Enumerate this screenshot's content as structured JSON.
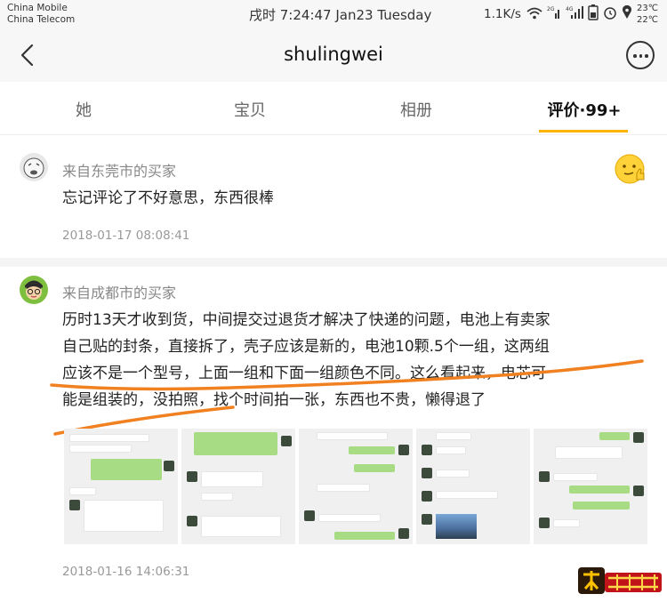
{
  "status_bar": {
    "carrier_1": "China Mobile",
    "carrier_2": "China Telecom",
    "time_text": "戌时 7:24:47 Jan23 Tuesday",
    "net_speed": "1.1K/s",
    "temp_1": "23℃",
    "temp_2": "22℃",
    "icons": [
      "wifi-icon",
      "signal-2g-icon",
      "signal-4g-icon",
      "battery-icon",
      "alarm-icon",
      "gps-icon"
    ]
  },
  "nav": {
    "title": "shulingwei",
    "back_icon": "chevron-left-icon",
    "more_icon": "more-dots-icon"
  },
  "tabs": [
    {
      "label": "她",
      "active": false
    },
    {
      "label": "宝贝",
      "active": false
    },
    {
      "label": "相册",
      "active": false
    },
    {
      "label": "评价·99+",
      "active": true
    }
  ],
  "accent_color": "#ffb400",
  "reviews": [
    {
      "reviewer": "来自东莞市的买家",
      "text": "忘记评论了不好意思，东西很棒",
      "date": "2018-01-17 08:08:41"
    },
    {
      "reviewer": "来自成都市的买家",
      "lines": [
        "历时13天才收到货，中间提交过退货才解决了快递的问题，电池上有卖家",
        "自己贴的封条，直接拆了，壳子应该是新的，电池10颗.5个一组，这两组",
        "应该不是一个型号，上面一组和下面一组颜色不同。这么看起来，电芯可",
        "能是组装的，没拍照，找个时间拍一张，东西也不贵，懒得退了"
      ],
      "photo_count": 5,
      "date": "2018-01-16 14:06:31"
    }
  ],
  "annotation_color": "#f08020",
  "watermark_icon": "aihaozhe-logo-icon"
}
